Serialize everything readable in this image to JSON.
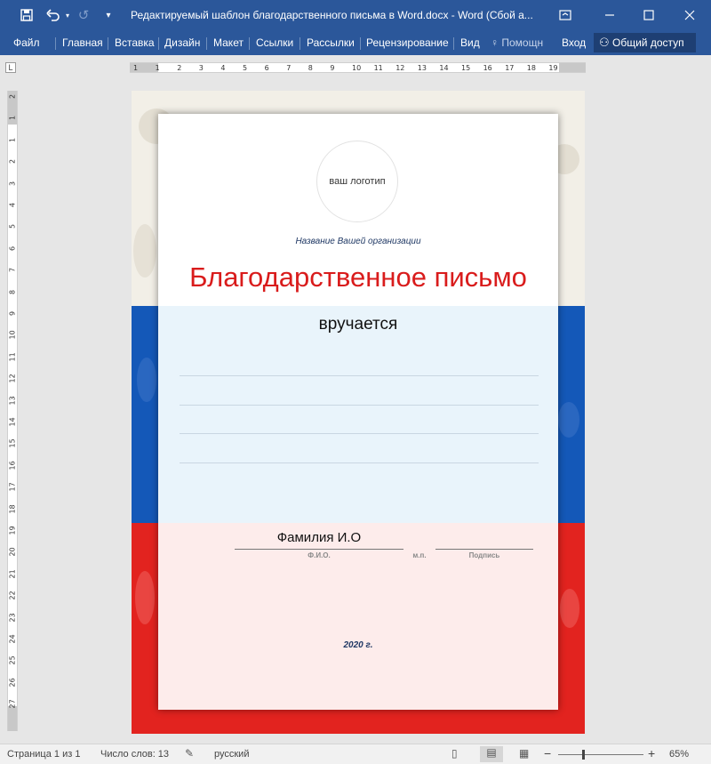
{
  "window": {
    "title": "Редактируемый шаблон благодарственного письма в Word.docx - Word (Сбой а...",
    "save_icon": "save-icon",
    "undo_icon": "undo-icon",
    "redo_icon": "redo-icon",
    "customize_icon": "customize-qat-icon",
    "ribbon_display_icon": "ribbon-display-options-icon",
    "minimize_icon": "minimize-icon",
    "maximize_icon": "maximize-icon",
    "close_icon": "close-icon"
  },
  "ribbon": {
    "tabs": [
      "Файл",
      "Главная",
      "Вставка",
      "Дизайн",
      "Макет",
      "Ссылки",
      "Рассылки",
      "Рецензирование",
      "Вид"
    ],
    "help_label": "Помощн",
    "signin_label": "Вход",
    "share_label": "Общий доступ"
  },
  "ruler": {
    "corner_label": "L",
    "h_numbers": [
      "1",
      "1",
      "2",
      "3",
      "4",
      "5",
      "6",
      "7",
      "8",
      "9",
      "10",
      "11",
      "12",
      "13",
      "14",
      "15",
      "16",
      "17",
      "18",
      "19"
    ],
    "v_numbers": [
      "2",
      "1",
      "1",
      "2",
      "3",
      "4",
      "5",
      "6",
      "7",
      "8",
      "9",
      "10",
      "11",
      "12",
      "13",
      "14",
      "15",
      "16",
      "17",
      "18",
      "19",
      "20",
      "21",
      "22",
      "23",
      "24",
      "25",
      "26",
      "27"
    ]
  },
  "document": {
    "logo_text": "ваш логотип",
    "organization": "Название Вашей организации",
    "heading": "Благодарственное письмо",
    "awarded": "вручается",
    "surname": "Фамилия И.О",
    "caption_name": "Ф.И.О.",
    "caption_stamp": "м.п.",
    "caption_signature": "Подпись",
    "year": "2020 г.",
    "colors": {
      "heading": "#d91c1c",
      "flag_blue": "#1458b8",
      "flag_red": "#e2231f",
      "org_text": "#1f3864"
    }
  },
  "status": {
    "page": "Страница 1 из 1",
    "words": "Число слов: 13",
    "language": "русский",
    "zoom": "65%",
    "zoom_minus": "−",
    "zoom_plus": "+"
  }
}
